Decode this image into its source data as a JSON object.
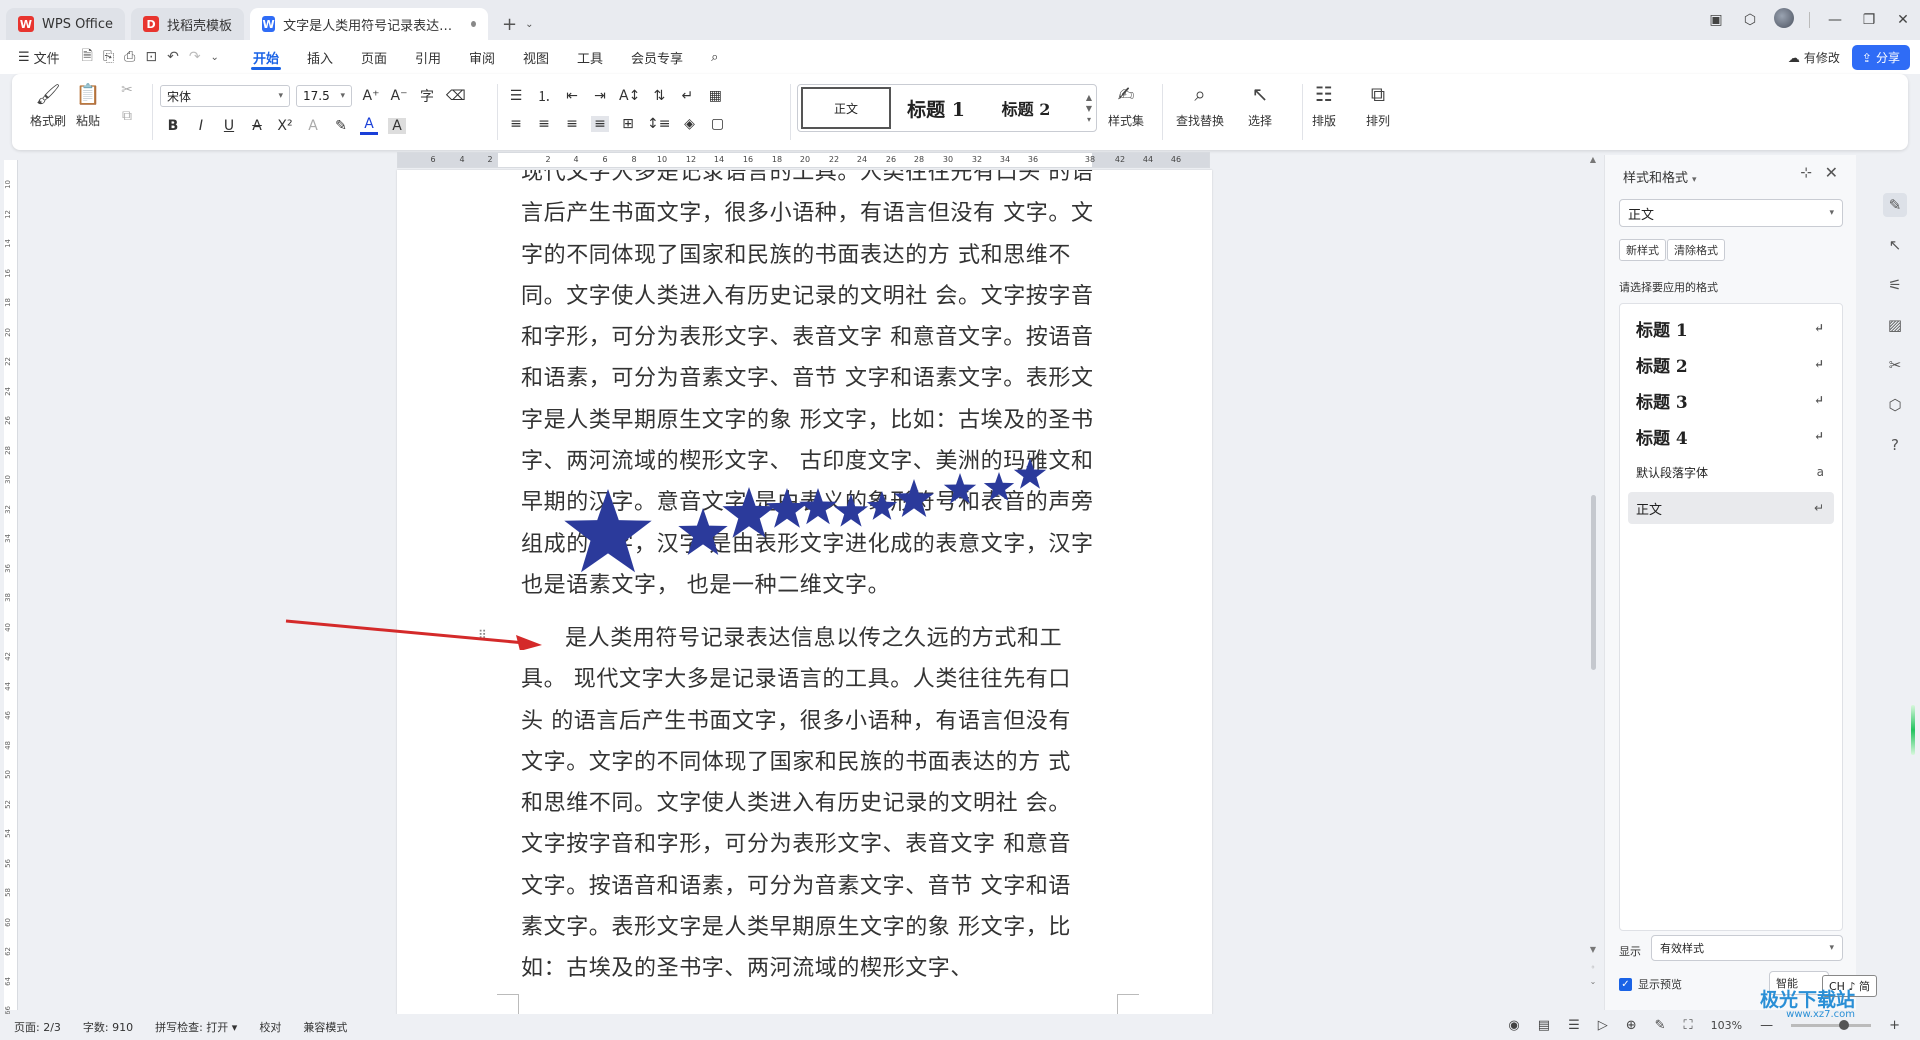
{
  "tabs": [
    {
      "label": "WPS Office",
      "icon": "wps-logo-icon",
      "color": "#e8352f"
    },
    {
      "label": "找稻壳模板",
      "icon": "docer-logo-icon",
      "color": "#e8352f"
    },
    {
      "label": "文字是人类用符号记录表达信息以传之久远的方式和工具",
      "icon": "writer-logo-icon",
      "color": "#2f6cf6"
    }
  ],
  "menu": {
    "file": "文件",
    "items": [
      "开始",
      "插入",
      "页面",
      "引用",
      "审阅",
      "视图",
      "工具",
      "会员专享"
    ],
    "active": "开始",
    "modify_label": "有修改",
    "share_label": "分享"
  },
  "ribbon": {
    "format_painter": "格式刷",
    "paste": "粘贴",
    "font_name": "宋体",
    "font_size": "17.5",
    "styles": {
      "normal": "正文",
      "h1": "标题 1",
      "h2": "标题 2"
    },
    "style_set": "样式集",
    "find_replace": "查找替换",
    "select": "选择",
    "layout": "排版",
    "arrange": "排列"
  },
  "ruler": {
    "h_ticks": [
      "6",
      "4",
      "2",
      "2",
      "4",
      "6",
      "8",
      "10",
      "12",
      "14",
      "16",
      "18",
      "20",
      "22",
      "24",
      "26",
      "28",
      "30",
      "32",
      "34",
      "36",
      "38",
      "42",
      "44",
      "46"
    ],
    "v_ticks": [
      "10",
      "12",
      "14",
      "16",
      "18",
      "20",
      "22",
      "24",
      "26",
      "28",
      "30",
      "32",
      "34",
      "36",
      "38",
      "40",
      "42",
      "44",
      "46",
      "48",
      "50",
      "52",
      "54",
      "56",
      "58",
      "60",
      "62",
      "64",
      "66"
    ]
  },
  "document": {
    "para1": "现代文字大多是记录语言的工具。人类往往先有口头 的语言后产生书面文字，很多小语种，有语言但没有 文字。文字的不同体现了国家和民族的书面表达的方 式和思维不同。文字使人类进入有历史记录的文明社 会。文字按字音和字形，可分为表形文字、表音文字 和意音文字。按语音和语素，可分为音素文字、音节 文字和语素文字。表形文字是人类早期原生文字的象 形文字，比如：古埃及的圣书字、两河流域的楔形文字、 古印度文字、美洲的玛雅文和早期的汉字。意音文字 是由表义的象形符号和表音的声旁组成的文字，汉字 是由表形文字进化成的表意文字，汉字也是语素文字， 也是一种二维文字。",
    "para2": "是人类用符号记录表达信息以传之久远的方式和工具。 现代文字大多是记录语言的工具。人类往往先有口头 的语言后产生书面文字，很多小语种，有语言但没有 文字。文字的不同体现了国家和民族的书面表达的方 式和思维不同。文字使人类进入有历史记录的文明社 会。文字按字音和字形，可分为表形文字、表音文字 和意音文字。按语音和语素，可分为音素文字、音节 文字和语素文字。表形文字是人类早期原生文字的象 形文字，比如：古埃及的圣书字、两河流域的楔形文字、",
    "star_color": "#2b3a9b",
    "arrow_color": "#d42a2a"
  },
  "styles_panel": {
    "title": "样式和格式",
    "current_style": "正文",
    "new_style": "新样式",
    "clear_format": "清除格式",
    "apply_label": "请选择要应用的格式",
    "items": [
      {
        "label": "标题 1",
        "mark": "↵"
      },
      {
        "label": "标题 2",
        "mark": "↵"
      },
      {
        "label": "标题 3",
        "mark": "↵"
      },
      {
        "label": "标题 4",
        "mark": "↵"
      },
      {
        "label": "默认段落字体",
        "mark": "a"
      },
      {
        "label": "正文",
        "mark": "↵"
      }
    ],
    "show_label": "显示",
    "show_value": "有效样式",
    "preview_label": "显示预览",
    "smart_label": "智能"
  },
  "ime": "CH ♪ 简",
  "status": {
    "page": "页面: 2/3",
    "words": "字数: 910",
    "spell": "拼写检查: 打开",
    "proof": "校对",
    "compat": "兼容模式",
    "zoom": "103%"
  },
  "watermark": {
    "main": "极光下载站",
    "sub": "www.xz7.com"
  }
}
